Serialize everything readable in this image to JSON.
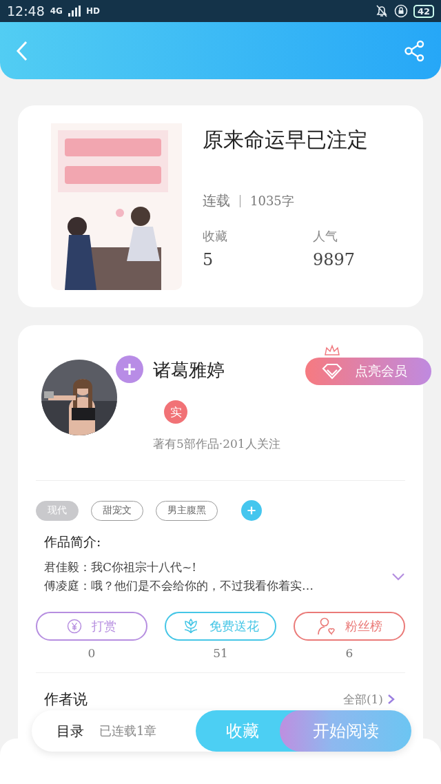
{
  "status_bar": {
    "time": "12:48",
    "network": "4G",
    "hd": "HD",
    "battery": "42"
  },
  "book": {
    "title": "原来命运早已注定",
    "status": "连载",
    "words": "1035字",
    "stats": [
      {
        "label": "收藏",
        "value": "5"
      },
      {
        "label": "人气",
        "value": "9897"
      }
    ]
  },
  "author": {
    "name": "诸葛雅婷",
    "badge": "实",
    "summary": "著有5部作品·201人关注",
    "vip_button": "点亮会员"
  },
  "tags": [
    {
      "label": "现代",
      "selected": true
    },
    {
      "label": "甜宠文",
      "selected": false
    },
    {
      "label": "男主腹黑",
      "selected": false
    }
  ],
  "intro": {
    "title": "作品简介:",
    "lines": [
      "君佳毅：我C你祖宗十八代~!",
      "傅凌庭：哦？他们是不会给你的，不过我看你着实…"
    ]
  },
  "actions": [
    {
      "kind": "coin",
      "label": "打赏",
      "count": "0",
      "color": "#b68ee0"
    },
    {
      "kind": "flower",
      "label": "免费送花",
      "count": "51",
      "color": "#45c6e6"
    },
    {
      "kind": "fans",
      "label": "粉丝榜",
      "count": "6",
      "color": "#ea7a78"
    }
  ],
  "author_notes": {
    "title": "作者说",
    "link": "全部(1)"
  },
  "bottom_bar": {
    "catalog": "目录",
    "chapters": "已连载1章",
    "collect": "收藏",
    "read": "开始阅读"
  }
}
